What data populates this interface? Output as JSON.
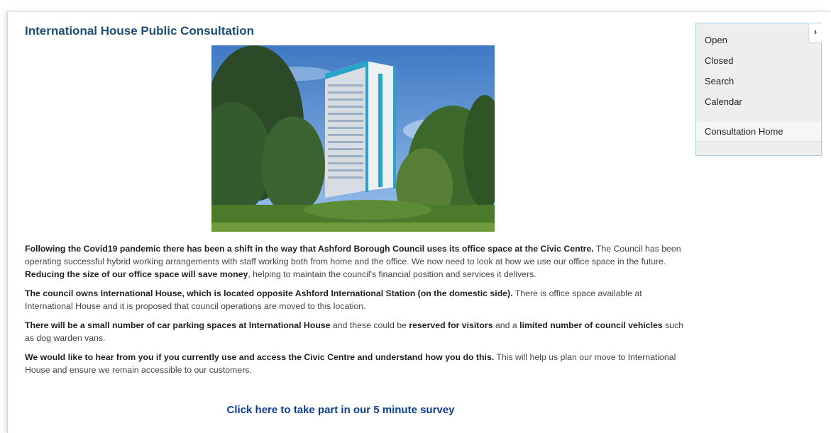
{
  "page": {
    "title": "International House Public Consultation"
  },
  "content": {
    "p1": {
      "bold1": "Following the Covid19 pandemic there has been a shift in the way that Ashford Borough Council uses its office space at the Civic Centre.",
      "text1": " The Council has been operating successful hybrid working arrangements with staff working both from home and the office. We now need to look at how we use our office space in the future. ",
      "bold2": "Reducing the size of our office space will save money",
      "text2": ", helping to maintain the council's financial position and services it delivers."
    },
    "p2": {
      "bold1": "The council owns International House, which is located opposite Ashford International Station (on the domestic side).",
      "text1": " There is office space available at International House and it is proposed that council operations are moved to this location."
    },
    "p3": {
      "bold1": "There will be a small number of car parking spaces at International House",
      "text1": " and these could be ",
      "bold2": "reserved for visitors",
      "text2": " and a ",
      "bold3": "limited number of council vehicles",
      "text3": " such as dog warden vans."
    },
    "p4": {
      "bold1": "We would like to hear from you if you currently use and access the Civic Centre and understand how you do this.",
      "text1": "  This will help us plan our move to International House and ensure we remain accessible to our customers."
    },
    "survey_link": "Click here to take part in our 5 minute survey"
  },
  "sidebar": {
    "toggle_icon": "chevron-right-icon",
    "toggle_glyph": "›",
    "items": [
      {
        "label": "Open"
      },
      {
        "label": "Closed"
      },
      {
        "label": "Search"
      },
      {
        "label": "Calendar"
      }
    ],
    "home": {
      "label": "Consultation Home"
    }
  },
  "colors": {
    "title": "#1b4f78",
    "link": "#0b3d91",
    "sidebar_border": "#a6cde0",
    "sidebar_bg": "#eeeeee"
  }
}
